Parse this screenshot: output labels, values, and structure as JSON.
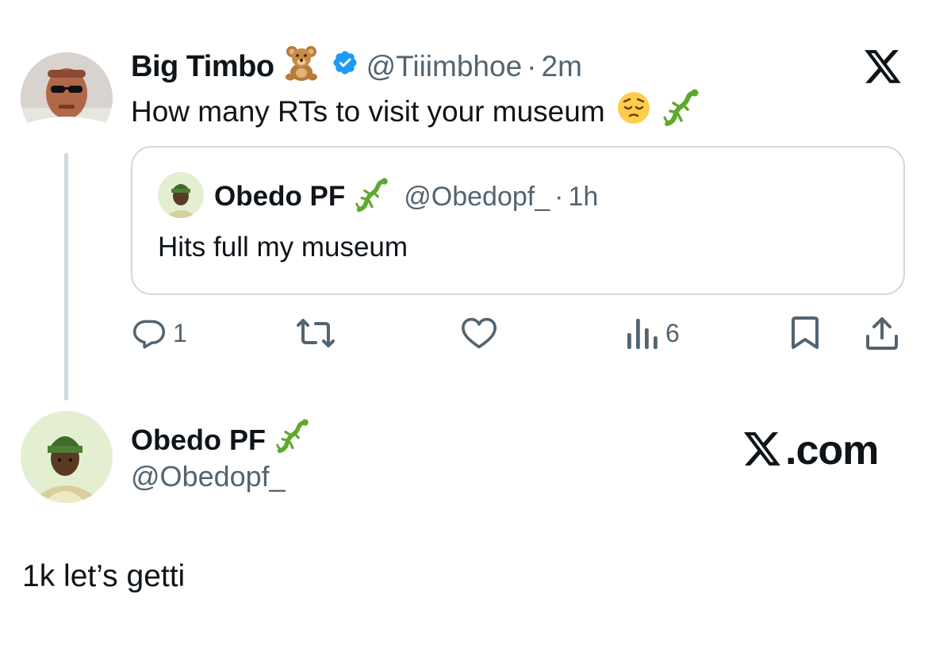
{
  "tweet": {
    "author_name": "Big Timbo",
    "author_emoji": "teddy-bear-emoji",
    "verified_icon": "verified-badge-icon",
    "handle": "@Tiiimbhoe",
    "separator": "·",
    "time": "2m",
    "text": "How many RTs to visit your museum",
    "text_emojis": [
      "pensive-face-emoji",
      "lizard-emoji"
    ],
    "brand_icon": "x-logo-icon"
  },
  "quoted": {
    "author_name": "Obedo PF",
    "author_emoji": "lizard-emoji",
    "handle": "@Obedopf_",
    "separator": "·",
    "time": "1h",
    "text": "Hits full my museum"
  },
  "actions": {
    "reply_count": "1",
    "views_count": "6",
    "icons": [
      "reply-icon",
      "retweet-icon",
      "like-icon",
      "views-icon",
      "bookmark-icon",
      "share-icon"
    ]
  },
  "profile": {
    "name": "Obedo PF",
    "emoji": "lizard-emoji",
    "handle": "@Obedopf_"
  },
  "watermark": {
    "text": ".com"
  },
  "reply": {
    "text": "1k let’s getti"
  },
  "colors": {
    "text": "#0f1419",
    "muted": "#536471",
    "border": "#cfd9de",
    "verified": "#1d9bf0"
  }
}
